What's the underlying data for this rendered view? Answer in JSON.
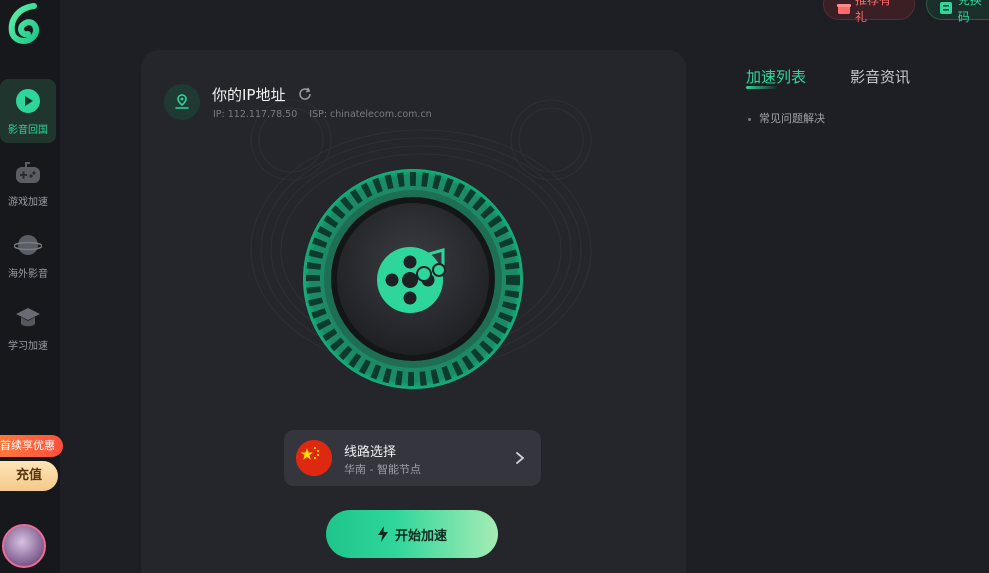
{
  "sidebar": {
    "items": [
      {
        "label": "影音回国",
        "icon": "play-circle-icon",
        "active": true
      },
      {
        "label": "游戏加速",
        "icon": "gamepad-icon",
        "active": false
      },
      {
        "label": "海外影音",
        "icon": "planet-icon",
        "active": false
      },
      {
        "label": "学习加速",
        "icon": "graduation-cap-icon",
        "active": false
      }
    ],
    "promo_badge": "首续享优惠",
    "recharge_label": "充值"
  },
  "header": {
    "recommend_label": "推荐有礼",
    "redeem_label": "兑换码"
  },
  "ip_card": {
    "title": "你的IP地址",
    "ip": "IP: 112.117.78.50",
    "isp": "ISP: chinatelecom.com.cn"
  },
  "route": {
    "title": "线路选择",
    "subtitle": "华南 - 智能节点"
  },
  "start_button_label": "开始加速",
  "right_panel": {
    "tabs": [
      {
        "label": "加速列表",
        "active": true
      },
      {
        "label": "影音资讯",
        "active": false
      }
    ],
    "faq": [
      "常见问题解决"
    ]
  },
  "colors": {
    "accent": "#2fd69b",
    "background": "#1e1f24",
    "card": "#25262c",
    "promo": "#ff5a3c",
    "recommend": "#ff6b6b"
  }
}
